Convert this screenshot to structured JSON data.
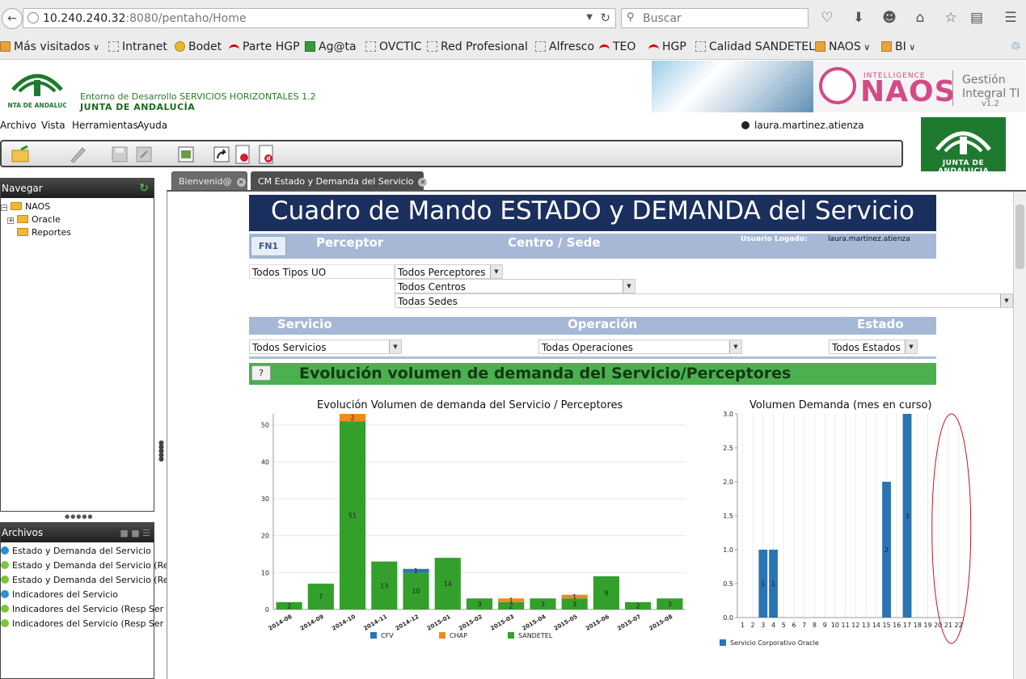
{
  "browser": {
    "url_host": "10.240.240.32",
    "url_rest": ":8080/pentaho/Home",
    "search_placeholder": "Buscar",
    "bookmarks": [
      {
        "label": "Más visitados",
        "icon": "folder",
        "dropdown": true
      },
      {
        "label": "Intranet",
        "icon": "page"
      },
      {
        "label": "Bodet",
        "icon": "flower"
      },
      {
        "label": "Parte HGP",
        "icon": "red"
      },
      {
        "label": "Ag@ta",
        "icon": "green"
      },
      {
        "label": "OVCTIC",
        "icon": "page"
      },
      {
        "label": "Red Profesional",
        "icon": "page"
      },
      {
        "label": "Alfresco",
        "icon": "page"
      },
      {
        "label": "TEO",
        "icon": "red"
      },
      {
        "label": "HGP",
        "icon": "red"
      },
      {
        "label": "Calidad SANDETEL",
        "icon": "page"
      },
      {
        "label": "NAOS",
        "icon": "folder",
        "dropdown": true
      },
      {
        "label": "BI",
        "icon": "folder",
        "dropdown": true
      }
    ]
  },
  "header": {
    "logo_text": "JUNTA DE ANDALUCIA",
    "env_title": "Entorno de Desarrollo SERVICIOS HORIZONTALES 1.2",
    "junta_name": "JUNTA DE ANDALUCÍA",
    "naos_intel": "INTELLIGENCE",
    "naos_word": "NAOS",
    "naos_gestion_1": "Gestión",
    "naos_gestion_2": "Integral TI",
    "naos_version": "v1.2",
    "junta_box_text": "JUNTA DE ANDALUCIA"
  },
  "menu": [
    "Archivo",
    "Vista",
    "Herramientas",
    "Ayuda"
  ],
  "user": "laura.martinez.atienza",
  "nav_panel": {
    "title": "Navegar",
    "tree": [
      {
        "label": "NAOS",
        "level": 0,
        "expander": "−"
      },
      {
        "label": "Oracle",
        "level": 1,
        "expander": "+"
      },
      {
        "label": "Reportes",
        "level": 1,
        "expander": ""
      }
    ]
  },
  "files_panel": {
    "title": "Archivos",
    "files": [
      {
        "label": "Estado y Demanda del Servicio",
        "color": "#2a8fd6"
      },
      {
        "label": "Estado y Demanda del Servicio (Re",
        "color": "#7cc63a"
      },
      {
        "label": "Estado y Demanda del Servicio (Re",
        "color": "#7cc63a"
      },
      {
        "label": "Indicadores del Servicio",
        "color": "#2a8fd6"
      },
      {
        "label": "Indicadores del Servicio (Resp Ser",
        "color": "#7cc63a"
      },
      {
        "label": "Indicadores del Servicio (Resp Ser",
        "color": "#7cc63a"
      }
    ]
  },
  "tabs": [
    {
      "label": "Bienvenid@",
      "active": false
    },
    {
      "label": "CM Estado y Demanda del Servicio",
      "active": true
    }
  ],
  "dashboard": {
    "title": "Cuadro de Mando ESTADO y DEMANDA del Servicio",
    "fn1": "FN1",
    "perceptor_label": "Perceptor",
    "centro_label": "Centro / Sede",
    "usuario_label": "Usuario Logado:",
    "usuario_value": "laura.martinez.atienza",
    "tipos_uo": "Todos Tipos UO",
    "perceptores": "Todos Perceptores",
    "centros": "Todos Centros",
    "sedes": "Todas Sedes",
    "servicio_label": "Servicio",
    "operacion_label": "Operación",
    "estado_label": "Estado",
    "servicios": "Todos Servicios",
    "operaciones": "Todas Operaciones",
    "estados": "Todos Estados",
    "help": "?",
    "section_title": "Evolución volumen de demanda del Servicio/Perceptores"
  },
  "colors": {
    "cfv": "#2a74b4",
    "chap": "#f08a1c",
    "sandetel": "#33a02c",
    "oracle": "#2a74b4",
    "navy": "#1b2f5e",
    "filter_bar": "#a6b8d6",
    "green_bar": "#4caf50"
  },
  "chart_data": [
    {
      "type": "bar",
      "stacked": true,
      "title": "Evolución Volumen de demanda del Servicio / Perceptores",
      "categories": [
        "2014-08",
        "2014-09",
        "2014-10",
        "2014-11",
        "2014-12",
        "2015-01",
        "2015-02",
        "2015-03",
        "2015-04",
        "2015-05",
        "2015-06",
        "2015-07",
        "2015-08"
      ],
      "series": [
        {
          "name": "CFV",
          "values": [
            0,
            0,
            0,
            0,
            1,
            0,
            0,
            0,
            0,
            0,
            0,
            0,
            0
          ]
        },
        {
          "name": "CHAP",
          "values": [
            0,
            0,
            2,
            0,
            0,
            0,
            0,
            1,
            0,
            1,
            0,
            0,
            0
          ]
        },
        {
          "name": "SANDETEL",
          "values": [
            2,
            7,
            51,
            13,
            10,
            14,
            3,
            2,
            3,
            3,
            9,
            2,
            3
          ]
        }
      ],
      "ylim": [
        0,
        53
      ],
      "yticks": [
        0,
        10,
        20,
        30,
        40,
        50
      ],
      "legend": "bottom"
    },
    {
      "type": "bar",
      "title": "Volumen Demanda (mes en curso)",
      "categories": [
        "1",
        "2",
        "3",
        "4",
        "5",
        "6",
        "7",
        "8",
        "9",
        "10",
        "11",
        "12",
        "13",
        "14",
        "15",
        "16",
        "17",
        "18",
        "19",
        "20",
        "21",
        "22"
      ],
      "series": [
        {
          "name": "Servicio Corporativo Oracle",
          "values": [
            0,
            0,
            1,
            1,
            0,
            0,
            0,
            0,
            0,
            0,
            0,
            0,
            0,
            0,
            2,
            0,
            3,
            0,
            0,
            0,
            0,
            0
          ]
        }
      ],
      "ylim": [
        0,
        3
      ],
      "yticks": [
        "0.0",
        "0.5",
        "1.0",
        "1.5",
        "2.0",
        "2.5",
        "3.0"
      ],
      "legend": "bottom-left"
    }
  ]
}
